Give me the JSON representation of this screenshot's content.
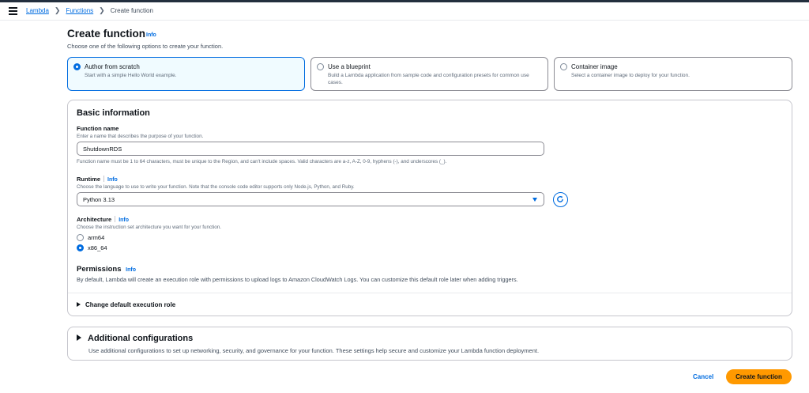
{
  "breadcrumbs": {
    "lambda": "Lambda",
    "functions": "Functions",
    "current": "Create function"
  },
  "header": {
    "title": "Create function",
    "info": "Info",
    "description": "Choose one of the following options to create your function."
  },
  "options": [
    {
      "title": "Author from scratch",
      "description": "Start with a simple Hello World example.",
      "selected": true
    },
    {
      "title": "Use a blueprint",
      "description": "Build a Lambda application from sample code and configuration presets for common use cases.",
      "selected": false
    },
    {
      "title": "Container image",
      "description": "Select a container image to deploy for your function.",
      "selected": false
    }
  ],
  "basic_info": {
    "title": "Basic information",
    "function_name": {
      "label": "Function name",
      "hint": "Enter a name that describes the purpose of your function.",
      "value": "ShutdownRDS",
      "constraint": "Function name must be 1 to 64 characters, must be unique to the Region, and can't include spaces. Valid characters are a-z, A-Z, 0-9, hyphens (-), and underscores (_)."
    },
    "runtime": {
      "label": "Runtime",
      "info": "Info",
      "hint": "Choose the language to use to write your function. Note that the console code editor supports only Node.js, Python, and Ruby.",
      "value": "Python 3.13"
    },
    "architecture": {
      "label": "Architecture",
      "info": "Info",
      "hint": "Choose the instruction set architecture you want for your function.",
      "options": [
        {
          "label": "arm64",
          "selected": false
        },
        {
          "label": "x86_64",
          "selected": true
        }
      ]
    },
    "permissions": {
      "label": "Permissions",
      "info": "Info",
      "description": "By default, Lambda will create an execution role with permissions to upload logs to Amazon CloudWatch Logs. You can customize this default role later when adding triggers."
    },
    "change_role": "Change default execution role"
  },
  "additional": {
    "title": "Additional configurations",
    "description": "Use additional configurations to set up networking, security, and governance for your function. These settings help secure and customize your Lambda function deployment."
  },
  "footer": {
    "cancel": "Cancel",
    "create": "Create function"
  },
  "colors": {
    "accent": "#006ce0",
    "primary_button": "#ff9900",
    "selected_tile_bg": "#f0fbff"
  },
  "icons": {
    "menu": "hamburger-icon",
    "refresh": "refresh-icon",
    "caret": "caret-down-icon",
    "expand": "triangle-right-icon",
    "breadcrumb_sep": "chevron-right-icon"
  }
}
